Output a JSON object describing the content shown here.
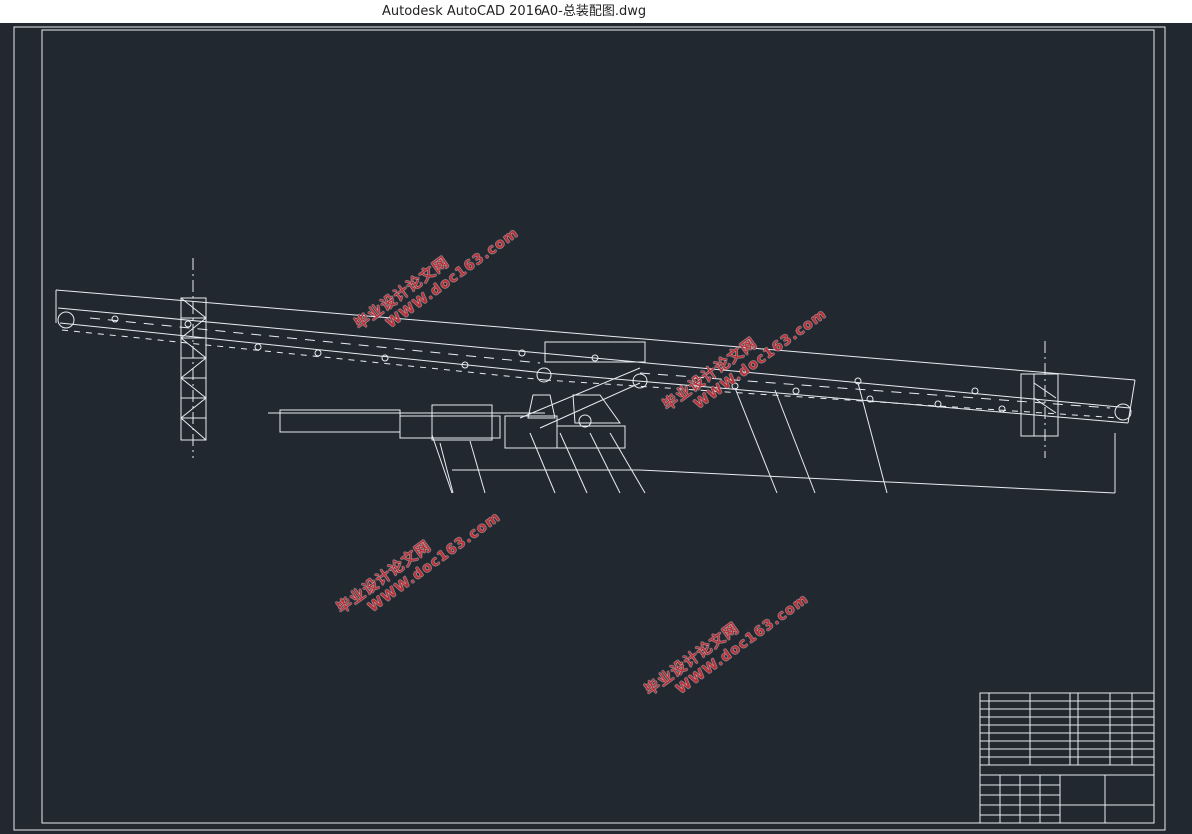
{
  "window": {
    "app_title": "Autodesk AutoCAD 2016",
    "doc_title": "A0-总装配图.dwg"
  },
  "watermark": {
    "line1": "毕业设计论文网",
    "line2": "WWW.doc163.com"
  },
  "colors": {
    "canvas": "#212830",
    "lines": "#e9edf2",
    "watermark": "#b8323a"
  }
}
